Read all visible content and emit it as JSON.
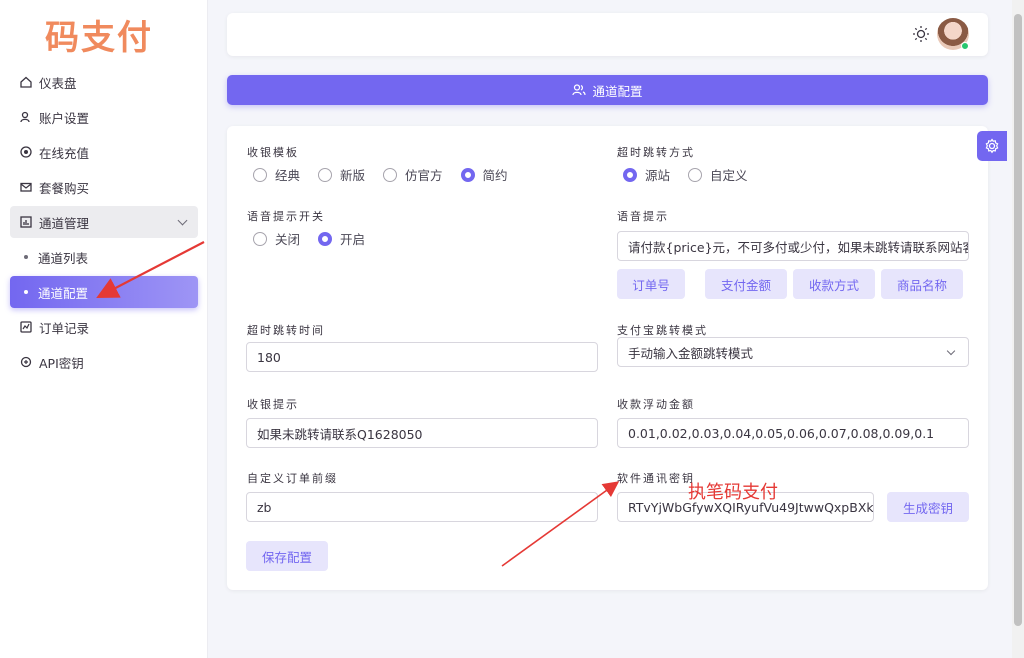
{
  "brand": {
    "logo_text": "码支付"
  },
  "sidebar": {
    "items": [
      {
        "label": "仪表盘",
        "icon": "home-icon"
      },
      {
        "label": "账户设置",
        "icon": "user-icon"
      },
      {
        "label": "在线充值",
        "icon": "coin-icon"
      },
      {
        "label": "套餐购买",
        "icon": "mail-icon"
      },
      {
        "label": "通道管理",
        "icon": "chart-icon"
      },
      {
        "label": "通道列表"
      },
      {
        "label": "通道配置"
      },
      {
        "label": "订单记录",
        "icon": "receipt-icon"
      },
      {
        "label": "API密钥",
        "icon": "key-icon"
      }
    ]
  },
  "header": {
    "title": "通道配置"
  },
  "form": {
    "cashier_template": {
      "label": "收银模板",
      "options": [
        "经典",
        "新版",
        "仿官方",
        "简约"
      ],
      "selected": "简约"
    },
    "timeout_redirect_mode": {
      "label": "超时跳转方式",
      "options": [
        "源站",
        "自定义"
      ],
      "selected": "源站"
    },
    "voice_switch": {
      "label": "语音提示开关",
      "options": [
        "关闭",
        "开启"
      ],
      "selected": "开启"
    },
    "voice_prompt": {
      "label": "语音提示",
      "value": "请付款{price}元，不可多付或少付，如果未跳转请联系网站客",
      "tags": [
        "订单号",
        "支付金额",
        "收款方式",
        "商品名称"
      ]
    },
    "timeout_redirect_time": {
      "label": "超时跳转时间",
      "value": "180"
    },
    "alipay_redirect_mode": {
      "label": "支付宝跳转模式",
      "value": "手动输入金额跳转模式"
    },
    "cashier_tip": {
      "label": "收银提示",
      "value": "如果未跳转请联系Q1628050"
    },
    "float_amount": {
      "label": "收款浮动金额",
      "value": "0.01,0.02,0.03,0.04,0.05,0.06,0.07,0.08,0.09,0.1"
    },
    "order_prefix": {
      "label": "自定义订单前缀",
      "value": "zb"
    },
    "software_key": {
      "label": "软件通讯密钥",
      "value": "RTvYjWbGfywXQIRyufVu49JtwwQxpBXk",
      "generate_label": "生成密钥"
    },
    "save_label": "保存配置"
  },
  "annotation": {
    "text": "执笔码支付",
    "color": "#e53935"
  },
  "colors": {
    "accent": "#7367f0",
    "logo": "#f08a5d"
  }
}
